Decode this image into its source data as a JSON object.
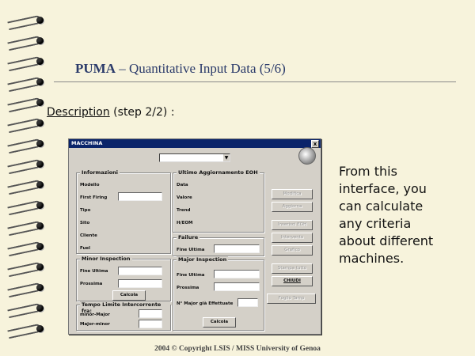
{
  "slide": {
    "title_bold": "PUMA",
    "title_rest": " – Quantitative Input Data (5/6)",
    "description_link": "Description",
    "description_rest": " (step 2/2) :",
    "side_text": "From this interface, you can calculate any criteria about different machines.",
    "footer": "2004 © Copyright LSIS / MISS University of Genoa"
  },
  "window": {
    "title": "MACCHINA",
    "close": "x",
    "combo_arrow": "▼",
    "informazioni": {
      "title": "Informazioni",
      "labels": [
        "Modello",
        "First Firing",
        "Tipo",
        "Sito",
        "Cliente",
        "Fuel"
      ]
    },
    "ultimo": {
      "title": "Ultimo Aggiornamento EOH",
      "labels": [
        "Data",
        "Valore",
        "Trend",
        "H/EOM"
      ]
    },
    "failure": {
      "title": "Failure",
      "fine_ultima": "Fine Ultima"
    },
    "minor": {
      "title": "Minor Inspection",
      "fine_ultima": "Fine Ultima",
      "prossima": "Prossima",
      "calcola": "Calcola"
    },
    "major": {
      "title": "Major Inspection",
      "fine_ultima": "Fine Ultima",
      "prossima": "Prossima",
      "n_major": "N° Major già Effettuate",
      "calcola": "Calcola"
    },
    "tempo": {
      "title": "Tempo Limite Intercorrente fra:",
      "minor_major": "minor-Major",
      "major_minor": "Major-minor"
    },
    "buttons": {
      "modifica": "Modifica",
      "aggiorna": "Aggiorna",
      "inserisci": "Inserisci EOH",
      "intervento": "Intervento",
      "grafico": "Grafico",
      "stampa": "Stampa tutto",
      "chiudi": "CHIUDI",
      "foglio": "Foglio Tamp"
    }
  }
}
